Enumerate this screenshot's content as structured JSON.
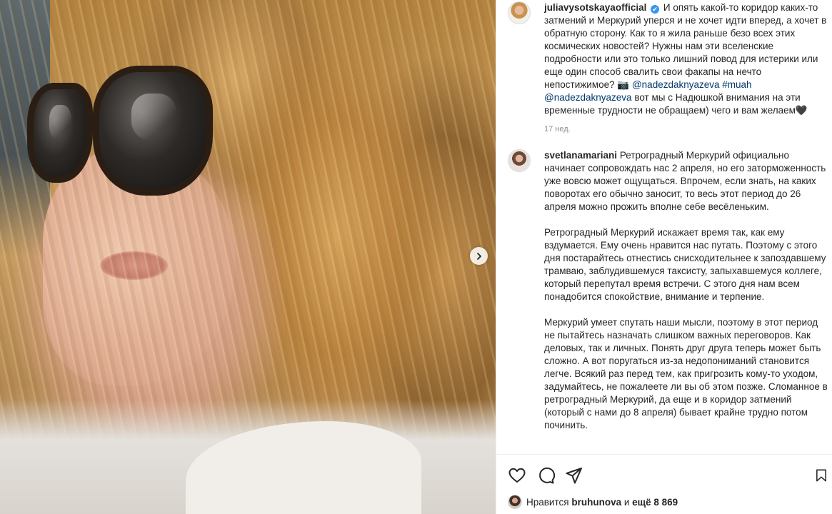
{
  "post": {
    "carousel_next_icon": "chevron-right-icon"
  },
  "caption": {
    "username": "juliavysotskaya",
    "username_suffix": "official",
    "verified_glyph": "✔",
    "text": "И опять какой-то коридор каких-то затмений и Меркурий уперся и не хочет идти вперед, а хочет в обратную сторону. Как то я жила раньше безо всех этих космических новостей? Нужны нам эти вселенские подробности или это только лишний повод для истерики или еще один способ свалить свои факапы на нечто непостижимое? 📷",
    "mention1": "@nadezdaknyazeva",
    "hashtag": "#muah",
    "mention2": "@nadezdaknyazeva",
    "text2": "вот мы с Надюшкой внимания на эти временные трудности не обращаем) чего и вам желаем🖤",
    "time": "17 нед."
  },
  "comment": {
    "username": "svetlanamariani",
    "para1": "Ретроградный Меркурий официально начинает сопровождать нас 2 апреля, но его заторможенность уже вовсю может ощущаться. Впрочем, если знать, на каких поворотах его обычно заносит, то весь этот период до 26 апреля можно прожить вполне себе весёленьким.",
    "para2": "Ретроградный Меркурий искажает время так, как ему вздумается. Ему очень нравится нас путать. Поэтому с этого дня постарайтесь отнестись снисходительнее к запоздавшему трамваю, заблудившемуся таксисту, запыхавшемуся коллеге, который перепутал время встречи. С этого дня нам всем понадобится спокойствие, внимание и терпение.",
    "para3": "Меркурий умеет спутать наши мысли, поэтому в этот период не пытайтесь назначать слишком важных переговоров. Как деловых, так и личных. Понять друг друга теперь может быть сложно. А вот поругаться из-за недопониманий становится легче. Всякий раз перед тем, как пригрозить кому-то уходом, задумайтесь, не пожалеете ли вы об этом позже. Сломанное в ретроградный Меркурий, да еще и в коридор затмений (который с нами до 8 апреля) бывает крайне трудно потом починить."
  },
  "actions": {
    "like_icon": "heart-icon",
    "comment_icon": "comment-icon",
    "share_icon": "share-icon",
    "save_icon": "bookmark-icon"
  },
  "likes": {
    "prefix": "Нравится",
    "user": "bruhunova",
    "middle": "и",
    "count": "ещё 8 869"
  }
}
